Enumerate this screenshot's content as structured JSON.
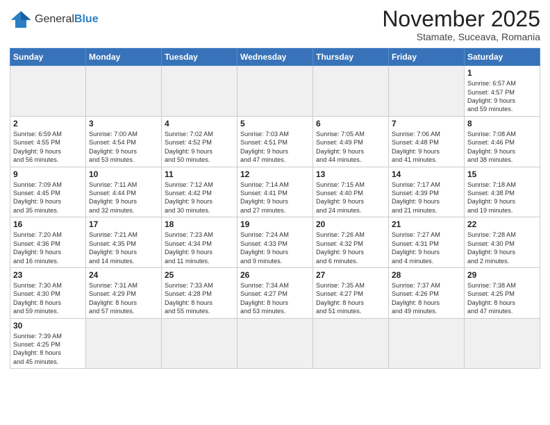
{
  "logo": {
    "text_general": "General",
    "text_blue": "Blue"
  },
  "title": "November 2025",
  "subtitle": "Stamate, Suceava, Romania",
  "days_of_week": [
    "Sunday",
    "Monday",
    "Tuesday",
    "Wednesday",
    "Thursday",
    "Friday",
    "Saturday"
  ],
  "weeks": [
    [
      {
        "day": "",
        "info": ""
      },
      {
        "day": "",
        "info": ""
      },
      {
        "day": "",
        "info": ""
      },
      {
        "day": "",
        "info": ""
      },
      {
        "day": "",
        "info": ""
      },
      {
        "day": "",
        "info": ""
      },
      {
        "day": "1",
        "info": "Sunrise: 6:57 AM\nSunset: 4:57 PM\nDaylight: 9 hours\nand 59 minutes."
      }
    ],
    [
      {
        "day": "2",
        "info": "Sunrise: 6:59 AM\nSunset: 4:55 PM\nDaylight: 9 hours\nand 56 minutes."
      },
      {
        "day": "3",
        "info": "Sunrise: 7:00 AM\nSunset: 4:54 PM\nDaylight: 9 hours\nand 53 minutes."
      },
      {
        "day": "4",
        "info": "Sunrise: 7:02 AM\nSunset: 4:52 PM\nDaylight: 9 hours\nand 50 minutes."
      },
      {
        "day": "5",
        "info": "Sunrise: 7:03 AM\nSunset: 4:51 PM\nDaylight: 9 hours\nand 47 minutes."
      },
      {
        "day": "6",
        "info": "Sunrise: 7:05 AM\nSunset: 4:49 PM\nDaylight: 9 hours\nand 44 minutes."
      },
      {
        "day": "7",
        "info": "Sunrise: 7:06 AM\nSunset: 4:48 PM\nDaylight: 9 hours\nand 41 minutes."
      },
      {
        "day": "8",
        "info": "Sunrise: 7:08 AM\nSunset: 4:46 PM\nDaylight: 9 hours\nand 38 minutes."
      }
    ],
    [
      {
        "day": "9",
        "info": "Sunrise: 7:09 AM\nSunset: 4:45 PM\nDaylight: 9 hours\nand 35 minutes."
      },
      {
        "day": "10",
        "info": "Sunrise: 7:11 AM\nSunset: 4:44 PM\nDaylight: 9 hours\nand 32 minutes."
      },
      {
        "day": "11",
        "info": "Sunrise: 7:12 AM\nSunset: 4:42 PM\nDaylight: 9 hours\nand 30 minutes."
      },
      {
        "day": "12",
        "info": "Sunrise: 7:14 AM\nSunset: 4:41 PM\nDaylight: 9 hours\nand 27 minutes."
      },
      {
        "day": "13",
        "info": "Sunrise: 7:15 AM\nSunset: 4:40 PM\nDaylight: 9 hours\nand 24 minutes."
      },
      {
        "day": "14",
        "info": "Sunrise: 7:17 AM\nSunset: 4:39 PM\nDaylight: 9 hours\nand 21 minutes."
      },
      {
        "day": "15",
        "info": "Sunrise: 7:18 AM\nSunset: 4:38 PM\nDaylight: 9 hours\nand 19 minutes."
      }
    ],
    [
      {
        "day": "16",
        "info": "Sunrise: 7:20 AM\nSunset: 4:36 PM\nDaylight: 9 hours\nand 16 minutes."
      },
      {
        "day": "17",
        "info": "Sunrise: 7:21 AM\nSunset: 4:35 PM\nDaylight: 9 hours\nand 14 minutes."
      },
      {
        "day": "18",
        "info": "Sunrise: 7:23 AM\nSunset: 4:34 PM\nDaylight: 9 hours\nand 11 minutes."
      },
      {
        "day": "19",
        "info": "Sunrise: 7:24 AM\nSunset: 4:33 PM\nDaylight: 9 hours\nand 9 minutes."
      },
      {
        "day": "20",
        "info": "Sunrise: 7:26 AM\nSunset: 4:32 PM\nDaylight: 9 hours\nand 6 minutes."
      },
      {
        "day": "21",
        "info": "Sunrise: 7:27 AM\nSunset: 4:31 PM\nDaylight: 9 hours\nand 4 minutes."
      },
      {
        "day": "22",
        "info": "Sunrise: 7:28 AM\nSunset: 4:30 PM\nDaylight: 9 hours\nand 2 minutes."
      }
    ],
    [
      {
        "day": "23",
        "info": "Sunrise: 7:30 AM\nSunset: 4:30 PM\nDaylight: 8 hours\nand 59 minutes."
      },
      {
        "day": "24",
        "info": "Sunrise: 7:31 AM\nSunset: 4:29 PM\nDaylight: 8 hours\nand 57 minutes."
      },
      {
        "day": "25",
        "info": "Sunrise: 7:33 AM\nSunset: 4:28 PM\nDaylight: 8 hours\nand 55 minutes."
      },
      {
        "day": "26",
        "info": "Sunrise: 7:34 AM\nSunset: 4:27 PM\nDaylight: 8 hours\nand 53 minutes."
      },
      {
        "day": "27",
        "info": "Sunrise: 7:35 AM\nSunset: 4:27 PM\nDaylight: 8 hours\nand 51 minutes."
      },
      {
        "day": "28",
        "info": "Sunrise: 7:37 AM\nSunset: 4:26 PM\nDaylight: 8 hours\nand 49 minutes."
      },
      {
        "day": "29",
        "info": "Sunrise: 7:38 AM\nSunset: 4:25 PM\nDaylight: 8 hours\nand 47 minutes."
      }
    ],
    [
      {
        "day": "30",
        "info": "Sunrise: 7:39 AM\nSunset: 4:25 PM\nDaylight: 8 hours\nand 45 minutes."
      },
      {
        "day": "",
        "info": ""
      },
      {
        "day": "",
        "info": ""
      },
      {
        "day": "",
        "info": ""
      },
      {
        "day": "",
        "info": ""
      },
      {
        "day": "",
        "info": ""
      },
      {
        "day": "",
        "info": ""
      }
    ]
  ]
}
